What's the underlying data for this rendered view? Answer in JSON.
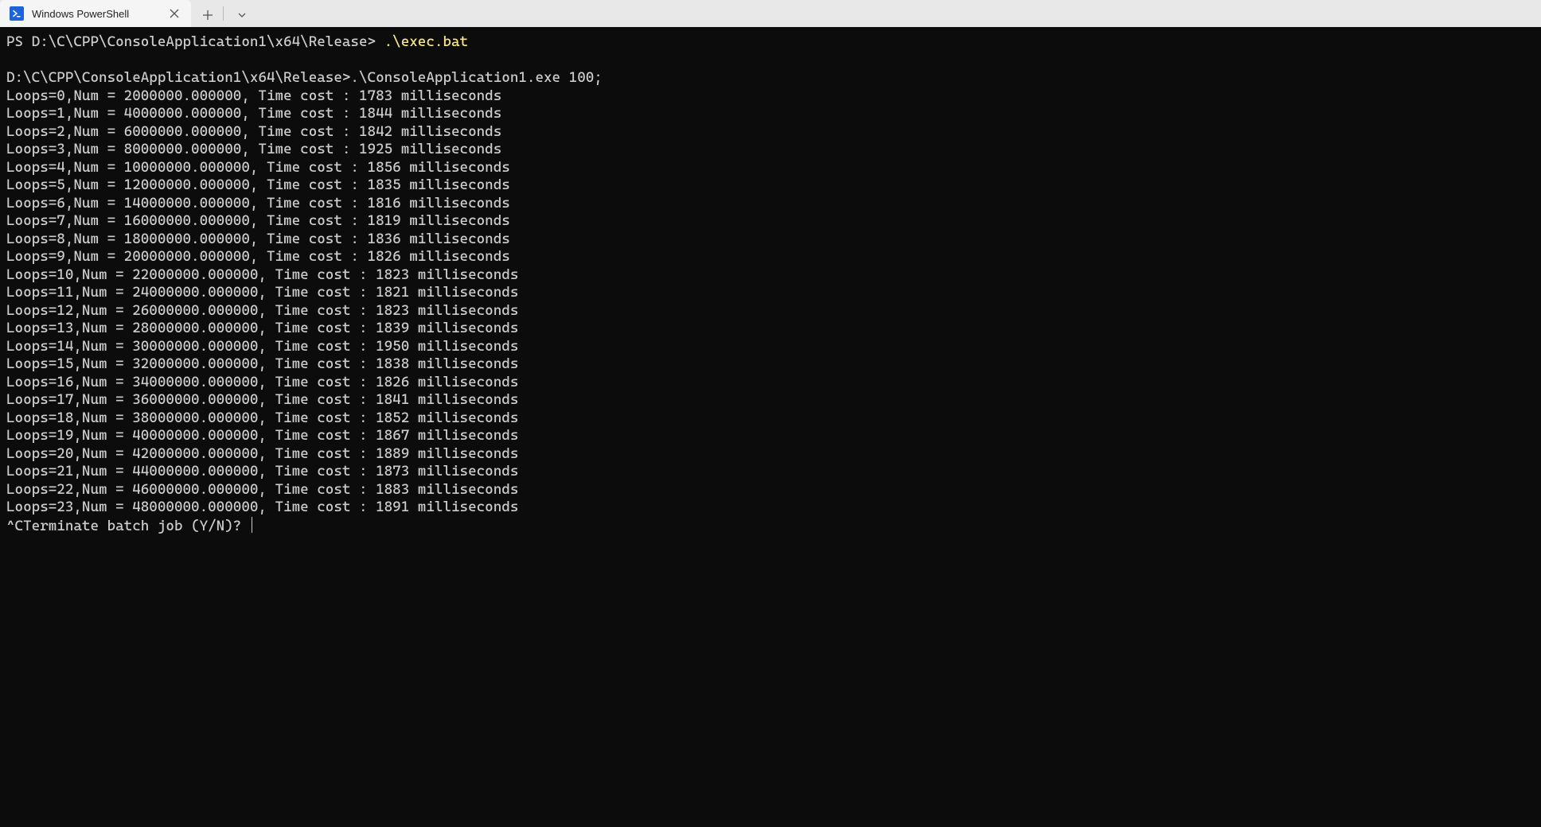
{
  "tab": {
    "title": "Windows PowerShell",
    "icon_glyph": ">_"
  },
  "prompt": {
    "prefix": "PS ",
    "path": "D:\\C\\CPP\\ConsoleApplication1\\x64\\Release>",
    "command": ".\\exec.bat"
  },
  "exec_line": "D:\\C\\CPP\\ConsoleApplication1\\x64\\Release>.\\ConsoleApplication1.exe 100;",
  "loops": [
    {
      "i": 0,
      "num": "2000000.000000",
      "ms": 1783
    },
    {
      "i": 1,
      "num": "4000000.000000",
      "ms": 1844
    },
    {
      "i": 2,
      "num": "6000000.000000",
      "ms": 1842
    },
    {
      "i": 3,
      "num": "8000000.000000",
      "ms": 1925
    },
    {
      "i": 4,
      "num": "10000000.000000",
      "ms": 1856
    },
    {
      "i": 5,
      "num": "12000000.000000",
      "ms": 1835
    },
    {
      "i": 6,
      "num": "14000000.000000",
      "ms": 1816
    },
    {
      "i": 7,
      "num": "16000000.000000",
      "ms": 1819
    },
    {
      "i": 8,
      "num": "18000000.000000",
      "ms": 1836
    },
    {
      "i": 9,
      "num": "20000000.000000",
      "ms": 1826
    },
    {
      "i": 10,
      "num": "22000000.000000",
      "ms": 1823
    },
    {
      "i": 11,
      "num": "24000000.000000",
      "ms": 1821
    },
    {
      "i": 12,
      "num": "26000000.000000",
      "ms": 1823
    },
    {
      "i": 13,
      "num": "28000000.000000",
      "ms": 1839
    },
    {
      "i": 14,
      "num": "30000000.000000",
      "ms": 1950
    },
    {
      "i": 15,
      "num": "32000000.000000",
      "ms": 1838
    },
    {
      "i": 16,
      "num": "34000000.000000",
      "ms": 1826
    },
    {
      "i": 17,
      "num": "36000000.000000",
      "ms": 1841
    },
    {
      "i": 18,
      "num": "38000000.000000",
      "ms": 1852
    },
    {
      "i": 19,
      "num": "40000000.000000",
      "ms": 1867
    },
    {
      "i": 20,
      "num": "42000000.000000",
      "ms": 1889
    },
    {
      "i": 21,
      "num": "44000000.000000",
      "ms": 1873
    },
    {
      "i": 22,
      "num": "46000000.000000",
      "ms": 1883
    },
    {
      "i": 23,
      "num": "48000000.000000",
      "ms": 1891
    }
  ],
  "terminate_prompt": "^CTerminate batch job (Y/N)? "
}
